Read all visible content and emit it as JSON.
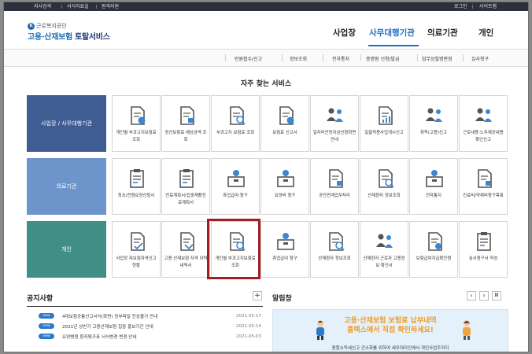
{
  "topbar": {
    "links": [
      "지사검색",
      "서식자료실",
      "원격지원"
    ],
    "right": [
      "로그인",
      "사이트맵"
    ]
  },
  "logo": {
    "org": "근로복지공단",
    "mark": "K",
    "title_a": "고용·산재보험",
    "title_b": " 토탈서비스"
  },
  "gnb": [
    "사업장",
    "사무대행기관",
    "의료기관",
    "개인"
  ],
  "subnav": [
    "민원접수/신고",
    "정보조회",
    "전자통지",
    "증명원 신청/발급",
    "업무상질병판정",
    "심사청구"
  ],
  "favorites_title": "자주 찾는 서비스",
  "rows": [
    {
      "label": "사업장 / 사무대행기관",
      "color": "#3f5d93",
      "tiles": [
        "개인별 부과고지보험료 조회",
        "정산보험료 예상금액 조회",
        "부과고지 보험료 조회",
        "보험료 신고서",
        "일자리안정자금신청화면안내",
        "일괄적용사업개시신고",
        "취득(고용)신고",
        "근로내용·노무제공내용 확인신고"
      ]
    },
    {
      "label": "의료기관",
      "color": "#6d95cc",
      "tiles": [
        "최초/전원요양신청서",
        "진료계획서/집중재활진료계획서",
        "휴업급여 청구",
        "요양비 청구",
        "공단연계업무처리",
        "산재환자 정보조회",
        "전자통지",
        "진료비/약제비청구목록"
      ]
    },
    {
      "label": "개인",
      "color": "#3f8f87",
      "tiles": [
        "사업장 피보험자격신고현황",
        "고용·산재보험 자격 이력 내역서",
        "개인별 부과고지보험료 조회",
        "휴업급여 청구",
        "산재환자 정보조회",
        "산재환자 근로자 고용정보 확인서",
        "보험급여지급확인원",
        "심사청구서 작성"
      ]
    }
  ],
  "notices": {
    "title": "공지사항",
    "plus": "+",
    "items": [
      {
        "badge": "new",
        "text": "4대보험공통신고서식(화면) 정부파일 전송불가 안내",
        "date": "2021-05-17"
      },
      {
        "badge": "new",
        "text": "2021년 상반기 고용산재보험 집중 홍보기간 안내",
        "date": "2021-05-14"
      },
      {
        "badge": "new",
        "text": "요양병원 환자평가표 서식변경 변경 안내",
        "date": "2021-05-03"
      }
    ]
  },
  "alarm": {
    "title": "알림창",
    "prev": "‹",
    "next": "›",
    "pause": "II",
    "banner_line1": "고용·산재보험 보험료 납부내역",
    "banner_line2": "홈택스에서 직접 확인하세요!",
    "banner_line3": "종합소득세신고 간소화를 위하여 세무대리인에서 개인사업주까지"
  }
}
